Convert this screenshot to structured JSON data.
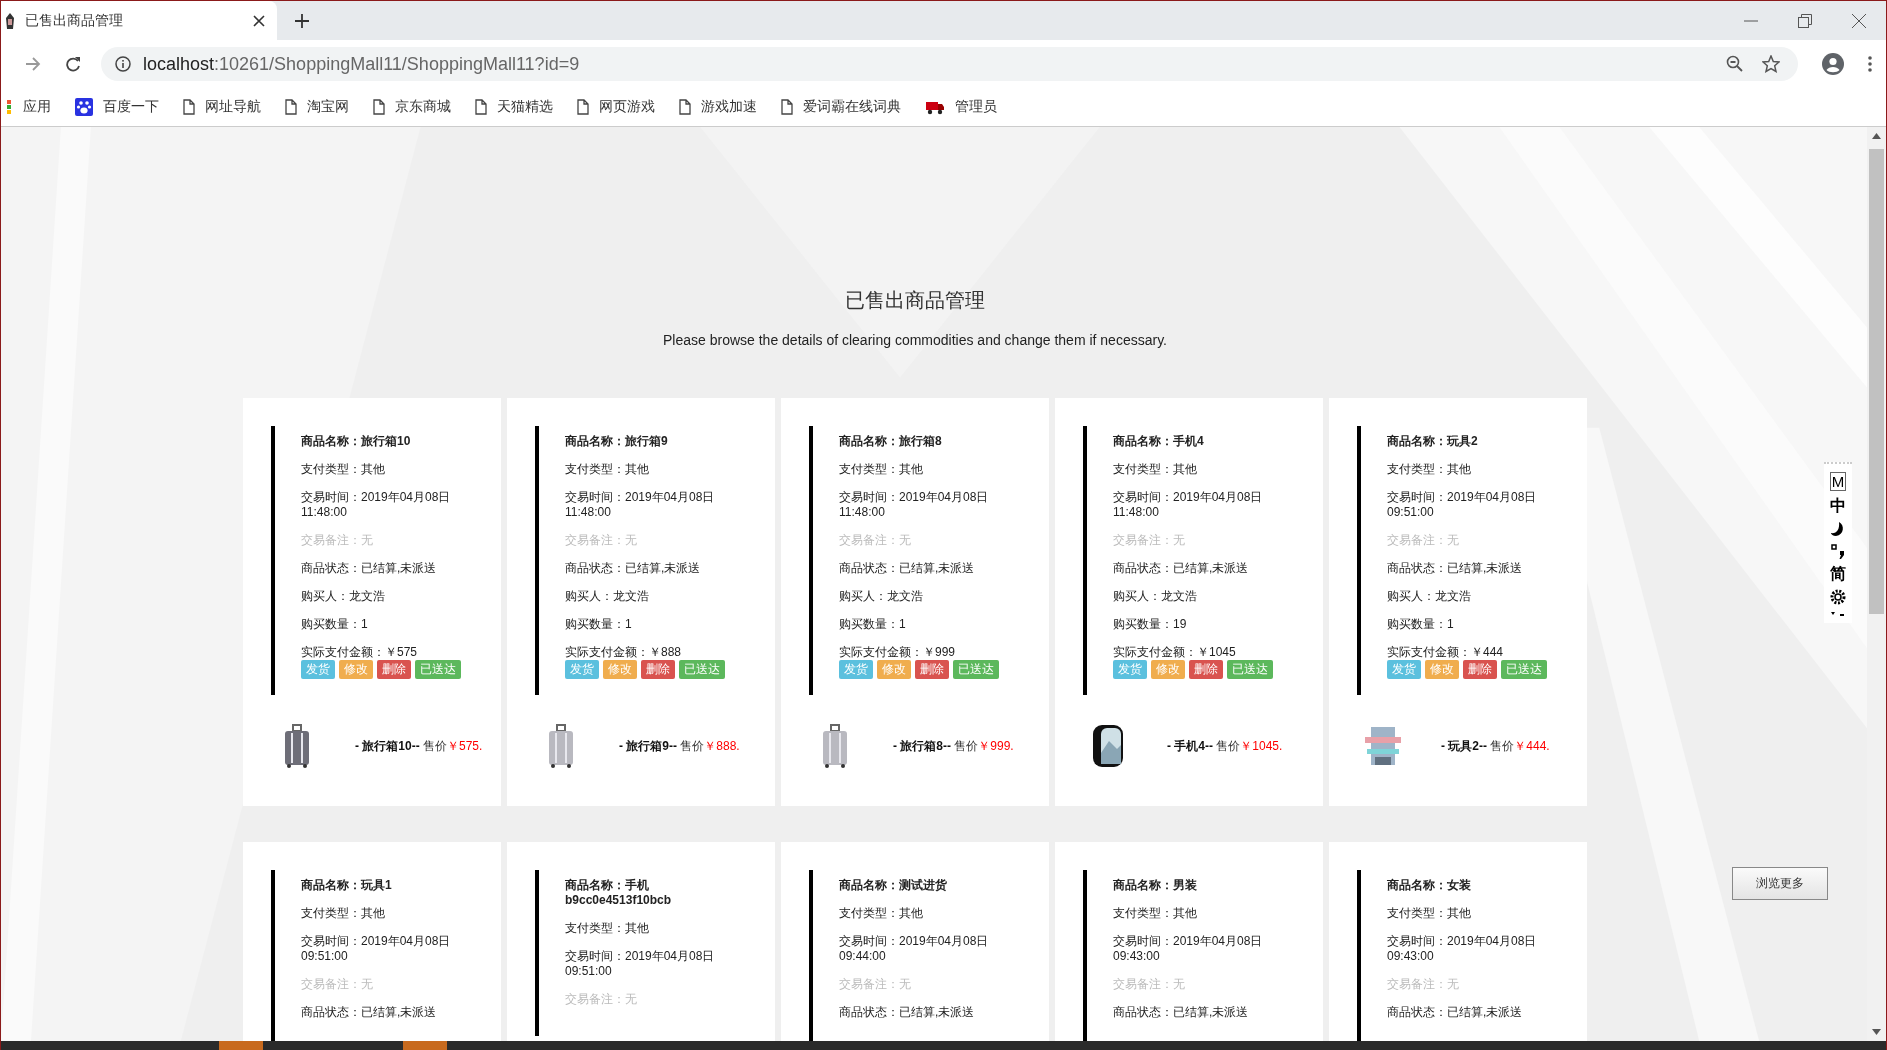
{
  "browser": {
    "tab_title": "已售出商品管理",
    "url_host": "localhost",
    "url_rest": ":10261/ShoppingMall11/ShoppingMall11?id=9",
    "bookmarks": [
      {
        "label": "应用",
        "kind": "apps"
      },
      {
        "label": "百度一下",
        "kind": "paw"
      },
      {
        "label": "网址导航",
        "kind": "page"
      },
      {
        "label": "淘宝网",
        "kind": "page"
      },
      {
        "label": "京东商城",
        "kind": "page"
      },
      {
        "label": "天猫精选",
        "kind": "page"
      },
      {
        "label": "网页游戏",
        "kind": "page"
      },
      {
        "label": "游戏加速",
        "kind": "page"
      },
      {
        "label": "爱词霸在线词典",
        "kind": "page"
      },
      {
        "label": "管理员",
        "kind": "truck"
      }
    ]
  },
  "page": {
    "title": "已售出商品管理",
    "subtitle": "Please browse the details of clearing commodities and change them if necessary.",
    "orders": [
      {
        "lines": [
          {
            "kind": "name",
            "text": "商品名称：旅行箱10"
          },
          {
            "kind": "plain",
            "text": "支付类型：其他"
          },
          {
            "kind": "plain",
            "text": "交易时间：2019年04月08日 11:48:00"
          },
          {
            "kind": "muted",
            "text": "交易备注：无"
          },
          {
            "kind": "plain",
            "text": "商品状态：已结算,未派送"
          },
          {
            "kind": "plain",
            "text": "购买人：龙文浩"
          },
          {
            "kind": "plain",
            "text": "购买数量：1"
          },
          {
            "kind": "tight",
            "text": "实际支付金额：￥575"
          }
        ],
        "actions": [
          {
            "kind": "ship",
            "label": "发货"
          },
          {
            "kind": "edit",
            "label": "修改"
          },
          {
            "kind": "delete",
            "label": "删除"
          },
          {
            "kind": "delivered",
            "label": "已送达"
          }
        ],
        "product": {
          "name": "- 旅行箱10--",
          "price_label": "售价",
          "price": "￥575."
        }
      },
      {
        "lines": [
          {
            "kind": "name",
            "text": "商品名称：旅行箱9"
          },
          {
            "kind": "plain",
            "text": "支付类型：其他"
          },
          {
            "kind": "plain",
            "text": "交易时间：2019年04月08日 11:48:00"
          },
          {
            "kind": "muted",
            "text": "交易备注：无"
          },
          {
            "kind": "plain",
            "text": "商品状态：已结算,未派送"
          },
          {
            "kind": "plain",
            "text": "购买人：龙文浩"
          },
          {
            "kind": "plain",
            "text": "购买数量：1"
          },
          {
            "kind": "tight",
            "text": "实际支付金额：￥888"
          }
        ],
        "actions": [
          {
            "kind": "ship",
            "label": "发货"
          },
          {
            "kind": "edit",
            "label": "修改"
          },
          {
            "kind": "delete",
            "label": "删除"
          },
          {
            "kind": "delivered",
            "label": "已送达"
          }
        ],
        "product": {
          "name": "- 旅行箱9--",
          "price_label": "售价",
          "price": "￥888."
        }
      },
      {
        "lines": [
          {
            "kind": "name",
            "text": "商品名称：旅行箱8"
          },
          {
            "kind": "plain",
            "text": "支付类型：其他"
          },
          {
            "kind": "plain",
            "text": "交易时间：2019年04月08日 11:48:00"
          },
          {
            "kind": "muted",
            "text": "交易备注：无"
          },
          {
            "kind": "plain",
            "text": "商品状态：已结算,未派送"
          },
          {
            "kind": "plain",
            "text": "购买人：龙文浩"
          },
          {
            "kind": "plain",
            "text": "购买数量：1"
          },
          {
            "kind": "tight",
            "text": "实际支付金额：￥999"
          }
        ],
        "actions": [
          {
            "kind": "ship",
            "label": "发货"
          },
          {
            "kind": "edit",
            "label": "修改"
          },
          {
            "kind": "delete",
            "label": "删除"
          },
          {
            "kind": "delivered",
            "label": "已送达"
          }
        ],
        "product": {
          "name": "- 旅行箱8--",
          "price_label": "售价",
          "price": "￥999."
        }
      },
      {
        "lines": [
          {
            "kind": "name",
            "text": "商品名称：手机4"
          },
          {
            "kind": "plain",
            "text": "支付类型：其他"
          },
          {
            "kind": "plain",
            "text": "交易时间：2019年04月08日 11:48:00"
          },
          {
            "kind": "muted",
            "text": "交易备注：无"
          },
          {
            "kind": "plain",
            "text": "商品状态：已结算,未派送"
          },
          {
            "kind": "plain",
            "text": "购买人：龙文浩"
          },
          {
            "kind": "plain",
            "text": "购买数量：19"
          },
          {
            "kind": "tight",
            "text": "实际支付金额：￥1045"
          }
        ],
        "actions": [
          {
            "kind": "ship",
            "label": "发货"
          },
          {
            "kind": "edit",
            "label": "修改"
          },
          {
            "kind": "delete",
            "label": "删除"
          },
          {
            "kind": "delivered",
            "label": "已送达"
          }
        ],
        "product": {
          "name": "- 手机4--",
          "price_label": "售价",
          "price": "￥1045."
        }
      },
      {
        "lines": [
          {
            "kind": "name",
            "text": "商品名称：玩具2"
          },
          {
            "kind": "plain",
            "text": "支付类型：其他"
          },
          {
            "kind": "plain",
            "text": "交易时间：2019年04月08日 09:51:00"
          },
          {
            "kind": "muted",
            "text": "交易备注：无"
          },
          {
            "kind": "plain",
            "text": "商品状态：已结算,未派送"
          },
          {
            "kind": "plain",
            "text": "购买人：龙文浩"
          },
          {
            "kind": "plain",
            "text": "购买数量：1"
          },
          {
            "kind": "tight",
            "text": "实际支付金额：￥444"
          }
        ],
        "actions": [
          {
            "kind": "ship",
            "label": "发货"
          },
          {
            "kind": "edit",
            "label": "修改"
          },
          {
            "kind": "delete",
            "label": "删除"
          },
          {
            "kind": "delivered",
            "label": "已送达"
          }
        ],
        "product": {
          "name": "- 玩具2--",
          "price_label": "售价",
          "price": "￥444."
        }
      },
      {
        "lines": [
          {
            "kind": "name",
            "text": "商品名称：玩具1"
          },
          {
            "kind": "plain",
            "text": "支付类型：其他"
          },
          {
            "kind": "plain",
            "text": "交易时间：2019年04月08日 09:51:00"
          },
          {
            "kind": "muted",
            "text": "交易备注：无"
          },
          {
            "kind": "plain",
            "text": "商品状态：已结算,未派送"
          }
        ]
      },
      {
        "lines": [
          {
            "kind": "name",
            "text": "商品名称：手机b9cc0e4513f10bcb"
          },
          {
            "kind": "plain",
            "text": "支付类型：其他"
          },
          {
            "kind": "plain",
            "text": "交易时间：2019年04月08日 09:51:00"
          },
          {
            "kind": "muted",
            "text": "交易备注：无"
          }
        ]
      },
      {
        "lines": [
          {
            "kind": "name",
            "text": "商品名称：测试进货"
          },
          {
            "kind": "plain",
            "text": "支付类型：其他"
          },
          {
            "kind": "plain",
            "text": "交易时间：2019年04月08日 09:44:00"
          },
          {
            "kind": "muted",
            "text": "交易备注：无"
          },
          {
            "kind": "plain",
            "text": "商品状态：已结算,未派送"
          }
        ]
      },
      {
        "lines": [
          {
            "kind": "name",
            "text": "商品名称：男装"
          },
          {
            "kind": "plain",
            "text": "支付类型：其他"
          },
          {
            "kind": "plain",
            "text": "交易时间：2019年04月08日 09:43:00"
          },
          {
            "kind": "muted",
            "text": "交易备注：无"
          },
          {
            "kind": "plain",
            "text": "商品状态：已结算,未派送"
          }
        ]
      },
      {
        "lines": [
          {
            "kind": "name",
            "text": "商品名称：女装"
          },
          {
            "kind": "plain",
            "text": "支付类型：其他"
          },
          {
            "kind": "plain",
            "text": "交易时间：2019年04月08日 09:43:00"
          },
          {
            "kind": "muted",
            "text": "交易备注：无"
          },
          {
            "kind": "plain",
            "text": "商品状态：已结算,未派送"
          }
        ]
      }
    ],
    "more_button": "浏览更多"
  },
  "ime_toolbar": {
    "mode": "M",
    "language": "中",
    "script": "简"
  }
}
